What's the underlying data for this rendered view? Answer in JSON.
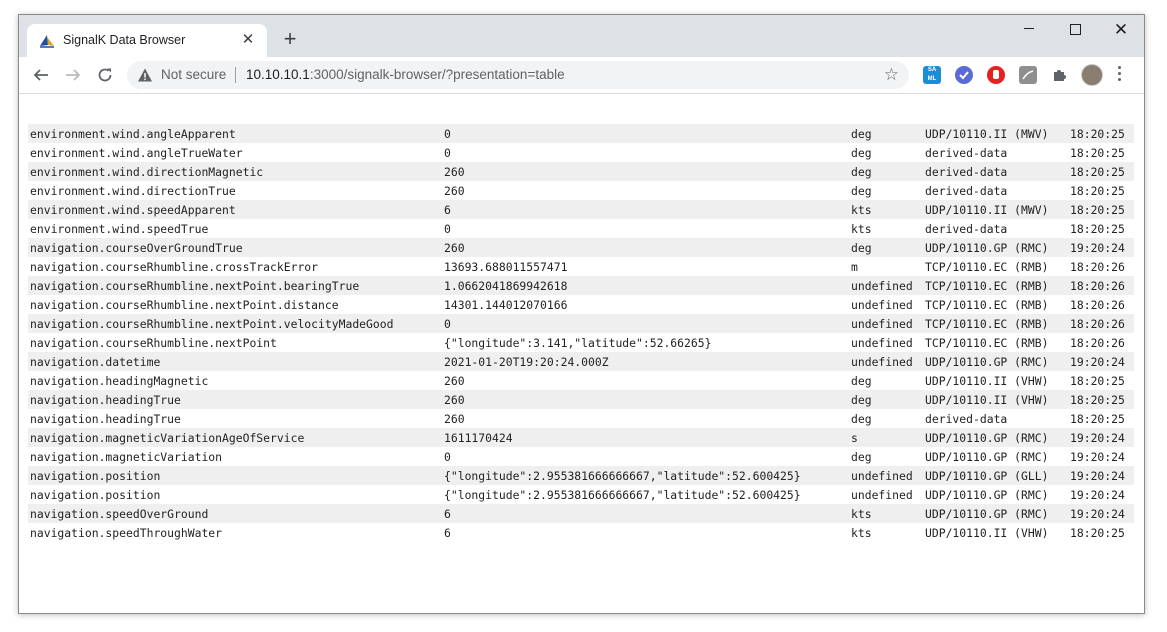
{
  "browser": {
    "tab_title": "SignalK Data Browser",
    "not_secure_label": "Not secure",
    "url_host": "10.10.10.1",
    "url_rest": ":3000/signalk-browser/?presentation=table",
    "extension_saml_label": "SA ML"
  },
  "table": {
    "rows": [
      {
        "path": "environment.wind.angleApparent",
        "value": "0",
        "unit": "deg",
        "source": "UDP/10110.II (MWV)",
        "time": "18:20:25"
      },
      {
        "path": "environment.wind.angleTrueWater",
        "value": "0",
        "unit": "deg",
        "source": "derived-data",
        "time": "18:20:25"
      },
      {
        "path": "environment.wind.directionMagnetic",
        "value": "260",
        "unit": "deg",
        "source": "derived-data",
        "time": "18:20:25"
      },
      {
        "path": "environment.wind.directionTrue",
        "value": "260",
        "unit": "deg",
        "source": "derived-data",
        "time": "18:20:25"
      },
      {
        "path": "environment.wind.speedApparent",
        "value": "6",
        "unit": "kts",
        "source": "UDP/10110.II (MWV)",
        "time": "18:20:25"
      },
      {
        "path": "environment.wind.speedTrue",
        "value": "0",
        "unit": "kts",
        "source": "derived-data",
        "time": "18:20:25"
      },
      {
        "path": "navigation.courseOverGroundTrue",
        "value": "260",
        "unit": "deg",
        "source": "UDP/10110.GP (RMC)",
        "time": "19:20:24"
      },
      {
        "path": "navigation.courseRhumbline.crossTrackError",
        "value": "13693.688011557471",
        "unit": "m",
        "source": "TCP/10110.EC (RMB)",
        "time": "18:20:26"
      },
      {
        "path": "navigation.courseRhumbline.nextPoint.bearingTrue",
        "value": "1.0662041869942618",
        "unit": "undefined",
        "source": "TCP/10110.EC (RMB)",
        "time": "18:20:26"
      },
      {
        "path": "navigation.courseRhumbline.nextPoint.distance",
        "value": "14301.144012070166",
        "unit": "undefined",
        "source": "TCP/10110.EC (RMB)",
        "time": "18:20:26"
      },
      {
        "path": "navigation.courseRhumbline.nextPoint.velocityMadeGood",
        "value": "0",
        "unit": "undefined",
        "source": "TCP/10110.EC (RMB)",
        "time": "18:20:26"
      },
      {
        "path": "navigation.courseRhumbline.nextPoint",
        "value": "{\"longitude\":3.141,\"latitude\":52.66265}",
        "unit": "undefined",
        "source": "TCP/10110.EC (RMB)",
        "time": "18:20:26"
      },
      {
        "path": "navigation.datetime",
        "value": "2021-01-20T19:20:24.000Z",
        "unit": "undefined",
        "source": "UDP/10110.GP (RMC)",
        "time": "19:20:24"
      },
      {
        "path": "navigation.headingMagnetic",
        "value": "260",
        "unit": "deg",
        "source": "UDP/10110.II (VHW)",
        "time": "18:20:25"
      },
      {
        "path": "navigation.headingTrue",
        "value": "260",
        "unit": "deg",
        "source": "UDP/10110.II (VHW)",
        "time": "18:20:25"
      },
      {
        "path": "navigation.headingTrue",
        "value": "260",
        "unit": "deg",
        "source": "derived-data",
        "time": "18:20:25"
      },
      {
        "path": "navigation.magneticVariationAgeOfService",
        "value": "1611170424",
        "unit": "s",
        "source": "UDP/10110.GP (RMC)",
        "time": "19:20:24"
      },
      {
        "path": "navigation.magneticVariation",
        "value": "0",
        "unit": "deg",
        "source": "UDP/10110.GP (RMC)",
        "time": "19:20:24"
      },
      {
        "path": "navigation.position",
        "value": "{\"longitude\":2.955381666666667,\"latitude\":52.600425}",
        "unit": "undefined",
        "source": "UDP/10110.GP (GLL)",
        "time": "19:20:24"
      },
      {
        "path": "navigation.position",
        "value": "{\"longitude\":2.955381666666667,\"latitude\":52.600425}",
        "unit": "undefined",
        "source": "UDP/10110.GP (RMC)",
        "time": "19:20:24"
      },
      {
        "path": "navigation.speedOverGround",
        "value": "6",
        "unit": "kts",
        "source": "UDP/10110.GP (RMC)",
        "time": "19:20:24"
      },
      {
        "path": "navigation.speedThroughWater",
        "value": "6",
        "unit": "kts",
        "source": "UDP/10110.II (VHW)",
        "time": "18:20:25"
      }
    ]
  }
}
